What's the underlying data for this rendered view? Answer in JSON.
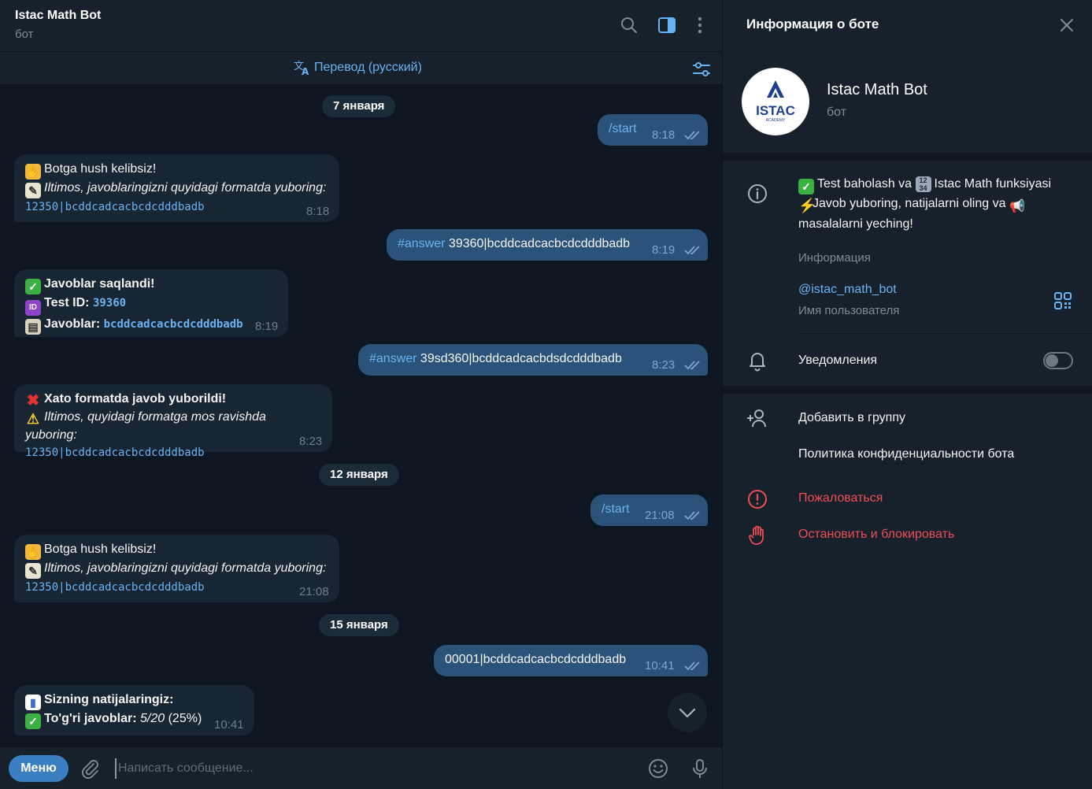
{
  "header": {
    "title": "Istac Math Bot",
    "subtitle": "бот"
  },
  "translate_bar": {
    "label": "Перевод (русский)"
  },
  "dates": [
    "7 января",
    "12 января",
    "15 января"
  ],
  "messages": {
    "m1": {
      "text": "/start",
      "time": "8:18"
    },
    "m2": {
      "line1": "Botga hush kelibsiz!",
      "line2": "Iltimos, javoblaringizni quyidagi formatda yuboring:",
      "code": "12350|bcddcadcacbcdcdddbadb",
      "time": "8:18"
    },
    "m3": {
      "tag": "#answer",
      "text": " 39360|bcddcadcacbcdcdddbadb",
      "time": "8:19"
    },
    "m4": {
      "line1": "Javoblar saqlandi!",
      "line2_label": "Test ID:",
      "line2_value": "39360",
      "line3_label": "Javoblar:",
      "line3_value": "bcddcadcacbcdcdddbadb",
      "time": "8:19"
    },
    "m5": {
      "tag": "#answer",
      "text": " 39sd360|bcddcadcacbdsdcdddbadb",
      "time": "8:23"
    },
    "m6": {
      "line1": "Xato formatda javob yuborildi!",
      "line2": "Iltimos, quyidagi formatga mos ravishda yuboring:",
      "code": "12350|bcddcadcacbcdcdddbadb",
      "time": "8:23"
    },
    "m7": {
      "text": "/start",
      "time": "21:08"
    },
    "m8": {
      "line1": "Botga hush kelibsiz!",
      "line2": "Iltimos, javoblaringizni quyidagi formatda yuboring:",
      "code": "12350|bcddcadcacbcdcdddbadb",
      "time": "21:08"
    },
    "m9": {
      "text": "00001|bcddcadcacbcdcdddbadb",
      "time": "10:41"
    },
    "m10": {
      "line1": "Sizning natijalaringiz:",
      "line2_label": "To'g'ri javoblar:",
      "line2_value": "5/20",
      "line2_pct": " (25%)",
      "time": "10:41"
    }
  },
  "composer": {
    "menu_label": "Меню",
    "placeholder": "Написать сообщение..."
  },
  "info": {
    "title": "Информация о боте",
    "bot_name": "Istac Math Bot",
    "bot_sub": "бот",
    "avatar_text": "ISTAC",
    "avatar_small": "ACADEMY",
    "about_1a": "Test baholash va",
    "about_1b": "Istac Math funksiyasi",
    "about_2a": "Javob yuboring, natijalarni oling va",
    "about_2b": "masalalarni yeching!",
    "about_label": "Информация",
    "username": "@istac_math_bot",
    "username_label": "Имя пользователя",
    "notifications": "Уведомления",
    "notifications_on": false,
    "add_to_group": "Добавить в группу",
    "privacy": "Политика конфиденциальности бота",
    "report": "Пожаловаться",
    "block": "Остановить и блокировать"
  },
  "colors": {
    "accent": "#6ab3f3",
    "outgoing_bubble": "#2b5278",
    "incoming_bubble": "#182533",
    "danger": "#ec4d56"
  }
}
